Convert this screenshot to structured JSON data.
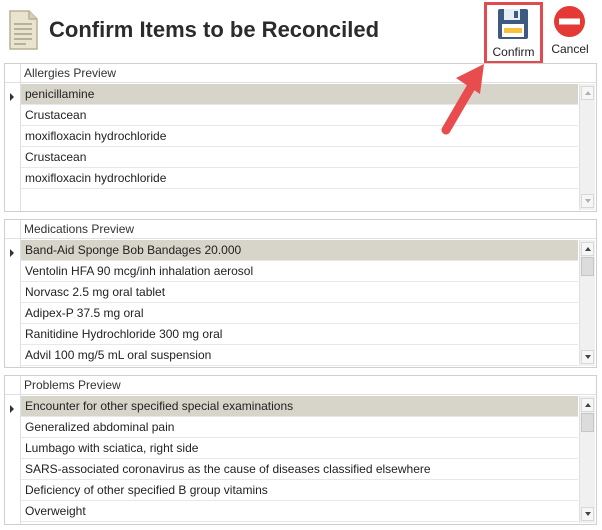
{
  "window": {
    "title": "Confirm Items to be Reconciled"
  },
  "toolbar": {
    "confirm_label": "Confirm",
    "cancel_label": "Cancel"
  },
  "colors": {
    "highlight_border": "#e24a4f",
    "arrow": "#e84c4f",
    "selected_row": "#d7d4c9",
    "cancel_icon": "#e53935"
  },
  "icons": {
    "document": "document-icon",
    "confirm": "save-disk-icon",
    "cancel": "cancel-circle-icon",
    "pointer": "red-arrow-icon"
  },
  "panels": {
    "allergies": {
      "title": "Allergies Preview",
      "rows": [
        "penicillamine",
        "Crustacean",
        "moxifloxacin hydrochloride",
        "Crustacean",
        "moxifloxacin hydrochloride"
      ]
    },
    "medications": {
      "title": "Medications Preview",
      "rows": [
        "Band-Aid Sponge Bob Bandages 20.000",
        "Ventolin HFA 90 mcg/inh inhalation aerosol",
        "Norvasc 2.5 mg oral tablet",
        "Adipex-P 37.5 mg oral",
        "Ranitidine Hydrochloride 300 mg oral",
        "Advil 100 mg/5 mL oral suspension"
      ]
    },
    "problems": {
      "title": "Problems Preview",
      "rows": [
        "Encounter for other specified special examinations",
        "Generalized abdominal pain",
        "Lumbago with sciatica, right side",
        "SARS-associated coronavirus as the cause of diseases classified elsewhere",
        "Deficiency of other specified B group vitamins",
        "Overweight"
      ]
    }
  }
}
